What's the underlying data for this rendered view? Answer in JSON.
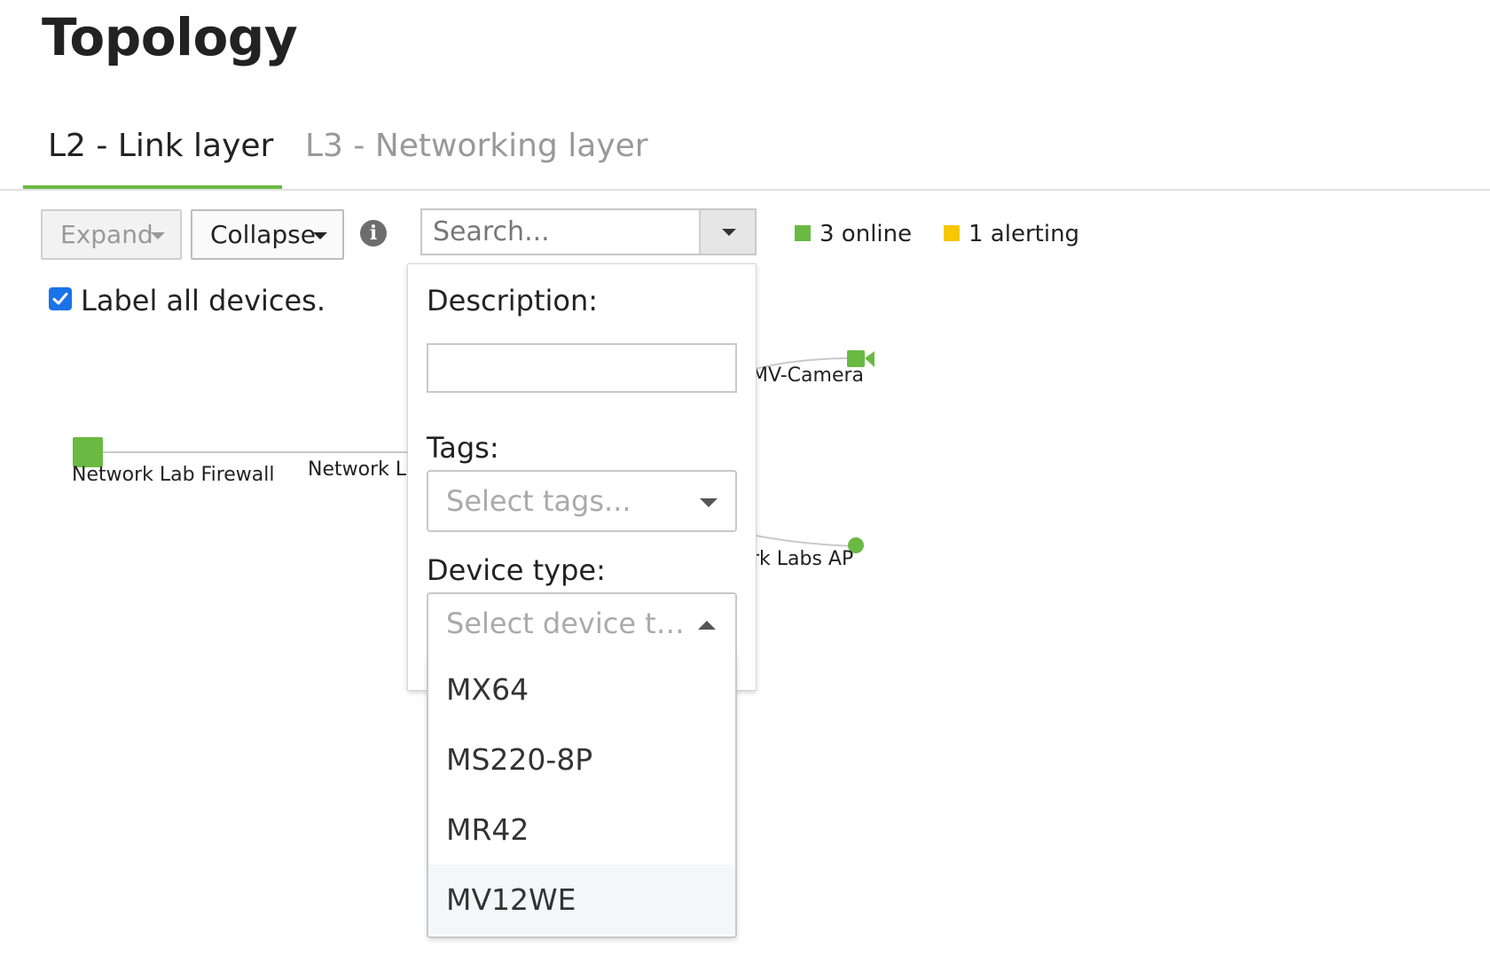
{
  "page": {
    "title": "Topology"
  },
  "tabs": [
    {
      "label": "L2 - Link layer",
      "active": true
    },
    {
      "label": "L3 - Networking layer",
      "active": false
    }
  ],
  "toolbar": {
    "expand_label": "Expand",
    "collapse_label": "Collapse",
    "info_glyph": "i",
    "search_placeholder": "Search...",
    "search_value": ""
  },
  "status": {
    "online": {
      "text": "3 online",
      "color": "#6ab942"
    },
    "alerting": {
      "text": "1 alerting",
      "color": "#f5c800"
    }
  },
  "options": {
    "label_all_text": "Label all devices.",
    "label_all_checked": true
  },
  "topology": {
    "nodes": {
      "firewall": "Network Lab Firewall",
      "switch": "Network L",
      "camera": "MV-Camera",
      "ap": "rk Labs AP"
    }
  },
  "filter_panel": {
    "description_label": "Description:",
    "description_value": "",
    "tags_label": "Tags:",
    "tags_placeholder": "Select tags...",
    "device_type_label": "Device type:",
    "device_type_placeholder": "Select device typ...",
    "device_type_options": [
      "MX64",
      "MS220-8P",
      "MR42",
      "MV12WE"
    ],
    "highlighted_option": "MV12WE"
  }
}
